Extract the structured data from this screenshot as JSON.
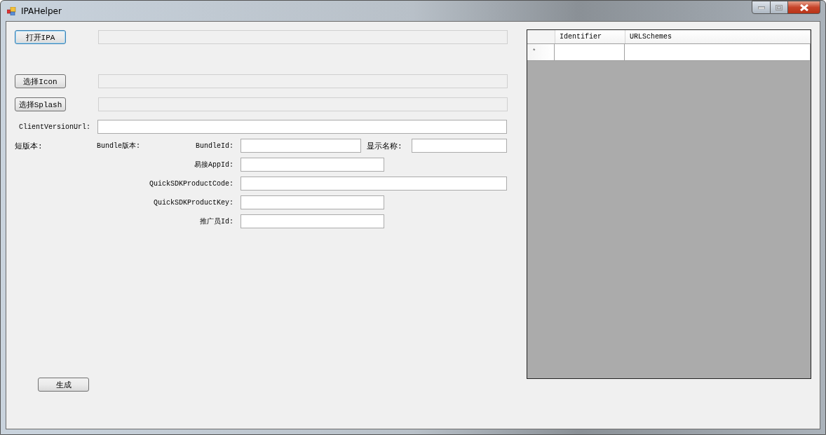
{
  "window": {
    "title": "IPAHelper"
  },
  "file_rows": [
    {
      "button": "打开IPA",
      "readonly": true,
      "focused": true
    },
    {
      "button": "选择Icon",
      "readonly": true,
      "focused": false
    },
    {
      "button": "选择Splash",
      "readonly": true,
      "focused": false
    }
  ],
  "client_version_url": {
    "label": "ClientVersionUrl:"
  },
  "version_labels": [
    "短版本:",
    "Bundle版本:"
  ],
  "bundle_id": {
    "label": "BundleId:"
  },
  "display_name": {
    "label": "显示名称:"
  },
  "fields": [
    {
      "label": "易接AppId:"
    },
    {
      "label": "QuickSDKProductCode:"
    },
    {
      "label": "QuickSDKProductKey:"
    },
    {
      "label": "推广员Id:"
    }
  ],
  "generate_button": "生成",
  "grid": {
    "columns": [
      "Identifier",
      "URLSchemes"
    ],
    "new_row_marker": "*"
  }
}
